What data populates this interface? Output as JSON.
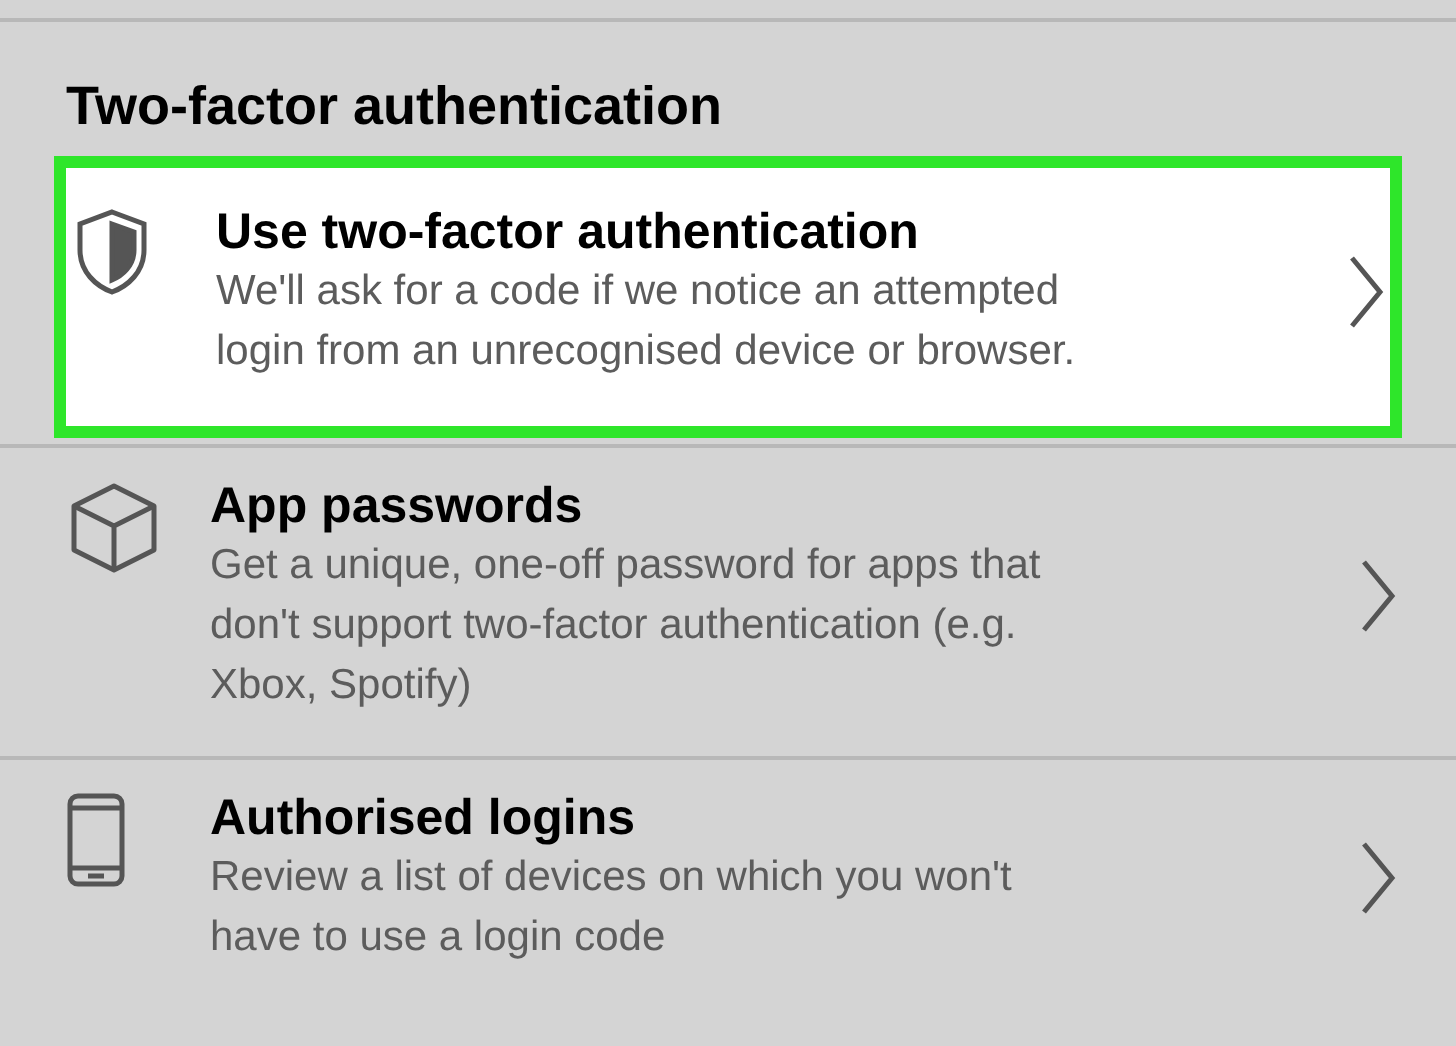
{
  "section": {
    "title": "Two-factor authentication"
  },
  "items": [
    {
      "kind": "shield",
      "title": "Use two-factor authentication",
      "description": [
        "We'll ask for a code if we notice an attempted",
        "login from an unrecognised device or browser."
      ],
      "highlighted": true
    },
    {
      "kind": "cube",
      "title": "App passwords",
      "description": [
        "Get a unique, one-off password for apps that",
        "don't support two-factor authentication (e.g.",
        "Xbox, Spotify)"
      ],
      "highlighted": false
    },
    {
      "kind": "phone",
      "title": "Authorised logins",
      "description": [
        "Review a list of devices on which you won't",
        "have to use a login code"
      ],
      "highlighted": false
    }
  ]
}
